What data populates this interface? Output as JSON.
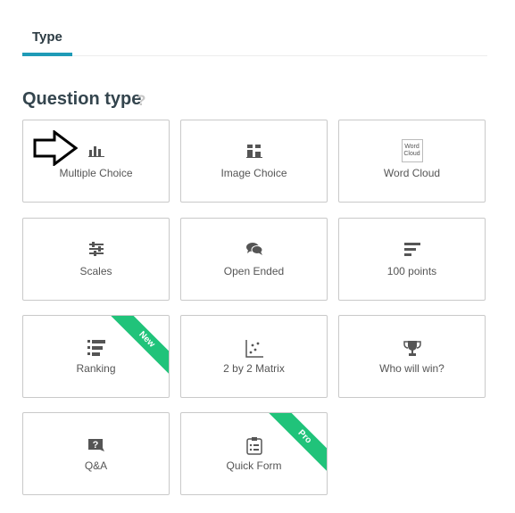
{
  "tabs": [
    {
      "label": "Type",
      "active": true
    }
  ],
  "section": {
    "title": "Question type",
    "help_glyph": "?"
  },
  "colors": {
    "accent": "#1f9bb7",
    "ribbon": "#20c37a",
    "icon": "#555555",
    "border": "#c9c9c9"
  },
  "question_types": [
    {
      "label": "Multiple Choice",
      "icon": "bar-chart-icon",
      "selected": true
    },
    {
      "label": "Image Choice",
      "icon": "image-choice-icon"
    },
    {
      "label": "Word Cloud",
      "icon": "word-cloud-icon",
      "icon_text": [
        "Word",
        "Cloud"
      ]
    },
    {
      "label": "Scales",
      "icon": "sliders-icon"
    },
    {
      "label": "Open Ended",
      "icon": "speech-bubbles-icon"
    },
    {
      "label": "100 points",
      "icon": "horizontal-bars-icon"
    },
    {
      "label": "Ranking",
      "icon": "ranking-icon",
      "badge": "New"
    },
    {
      "label": "2 by 2 Matrix",
      "icon": "scatter-matrix-icon"
    },
    {
      "label": "Who will win?",
      "icon": "trophy-icon"
    },
    {
      "label": "Q&A",
      "icon": "question-bubble-icon"
    },
    {
      "label": "Quick Form",
      "icon": "clipboard-form-icon",
      "badge": "Pro"
    }
  ]
}
